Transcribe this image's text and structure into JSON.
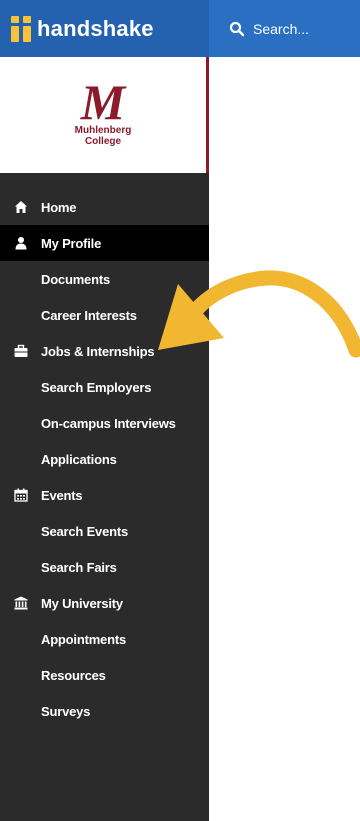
{
  "app": {
    "brand_name": "handshake",
    "search_placeholder": "Search..."
  },
  "school": {
    "name_line1": "Muhlenberg",
    "name_line2": "College",
    "monogram": "M"
  },
  "colors": {
    "topbar": "#2a6fc1",
    "brand_bg": "#2462b0",
    "brand_accent": "#f7c33a",
    "sidebar_bg": "#2b2b2b",
    "active_bg": "#000000",
    "school_red": "#8b1a2b",
    "arrow": "#f2b731"
  },
  "nav": {
    "home": {
      "label": "Home",
      "icon": "home-icon"
    },
    "profile": {
      "label": "My Profile",
      "icon": "user-icon"
    },
    "documents": {
      "label": "Documents"
    },
    "career_interests": {
      "label": "Career Interests"
    },
    "jobs": {
      "label": "Jobs & Internships",
      "icon": "briefcase-icon"
    },
    "search_employers": {
      "label": "Search Employers"
    },
    "oncampus": {
      "label": "On-campus Interviews"
    },
    "applications": {
      "label": "Applications"
    },
    "events": {
      "label": "Events",
      "icon": "calendar-icon"
    },
    "search_events": {
      "label": "Search Events"
    },
    "search_fairs": {
      "label": "Search Fairs"
    },
    "university": {
      "label": "My University",
      "icon": "university-icon"
    },
    "appointments": {
      "label": "Appointments"
    },
    "resources": {
      "label": "Resources"
    },
    "surveys": {
      "label": "Surveys"
    }
  },
  "annotation": {
    "icon": "curved-arrow-icon"
  }
}
